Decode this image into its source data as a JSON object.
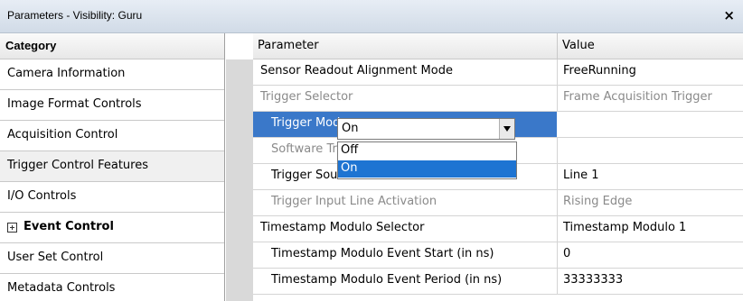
{
  "window": {
    "title": "Parameters - Visibility: Guru",
    "close_label": "×"
  },
  "categories": {
    "header": "Category",
    "items": [
      {
        "label": "Camera Information"
      },
      {
        "label": "Image Format Controls"
      },
      {
        "label": "Acquisition Control"
      },
      {
        "label": "Trigger Control Features",
        "selected": true
      },
      {
        "label": "I/O Controls"
      },
      {
        "label": "Event Control",
        "expander": true
      },
      {
        "label": "User Set Control"
      },
      {
        "label": "Metadata Controls"
      }
    ]
  },
  "grid": {
    "col_parameter": "Parameter",
    "col_value": "Value",
    "rows": [
      {
        "name": "Sensor Readout Alignment Mode",
        "value": "FreeRunning"
      },
      {
        "name": "Trigger Selector",
        "value": "Frame Acquisition Trigger",
        "disabled": true
      },
      {
        "name": "Trigger Mode",
        "value": "On",
        "selected": true
      },
      {
        "name": "Software Trigger",
        "value": "",
        "disabled": true
      },
      {
        "name": "Trigger Source",
        "value": "Line 1"
      },
      {
        "name": "Trigger Input Line Activation",
        "value": "Rising Edge",
        "disabled": true
      },
      {
        "name": "Timestamp Modulo Selector",
        "value": "Timestamp Modulo 1"
      },
      {
        "name": "Timestamp Modulo Event Start (in ns)",
        "value": "0"
      },
      {
        "name": "Timestamp Modulo Event Period (in ns)",
        "value": "33333333"
      }
    ]
  },
  "dropdown": {
    "current": "On",
    "options": [
      "Off",
      "On"
    ],
    "highlighted": "On"
  },
  "colors": {
    "selection": "#3a78c9",
    "highlight": "#1e74d2",
    "disabled_text": "#8a8a8a"
  },
  "icons": {
    "close": "close-icon",
    "expand": "plus-box-icon",
    "combo_arrow": "chevron-down-icon"
  }
}
